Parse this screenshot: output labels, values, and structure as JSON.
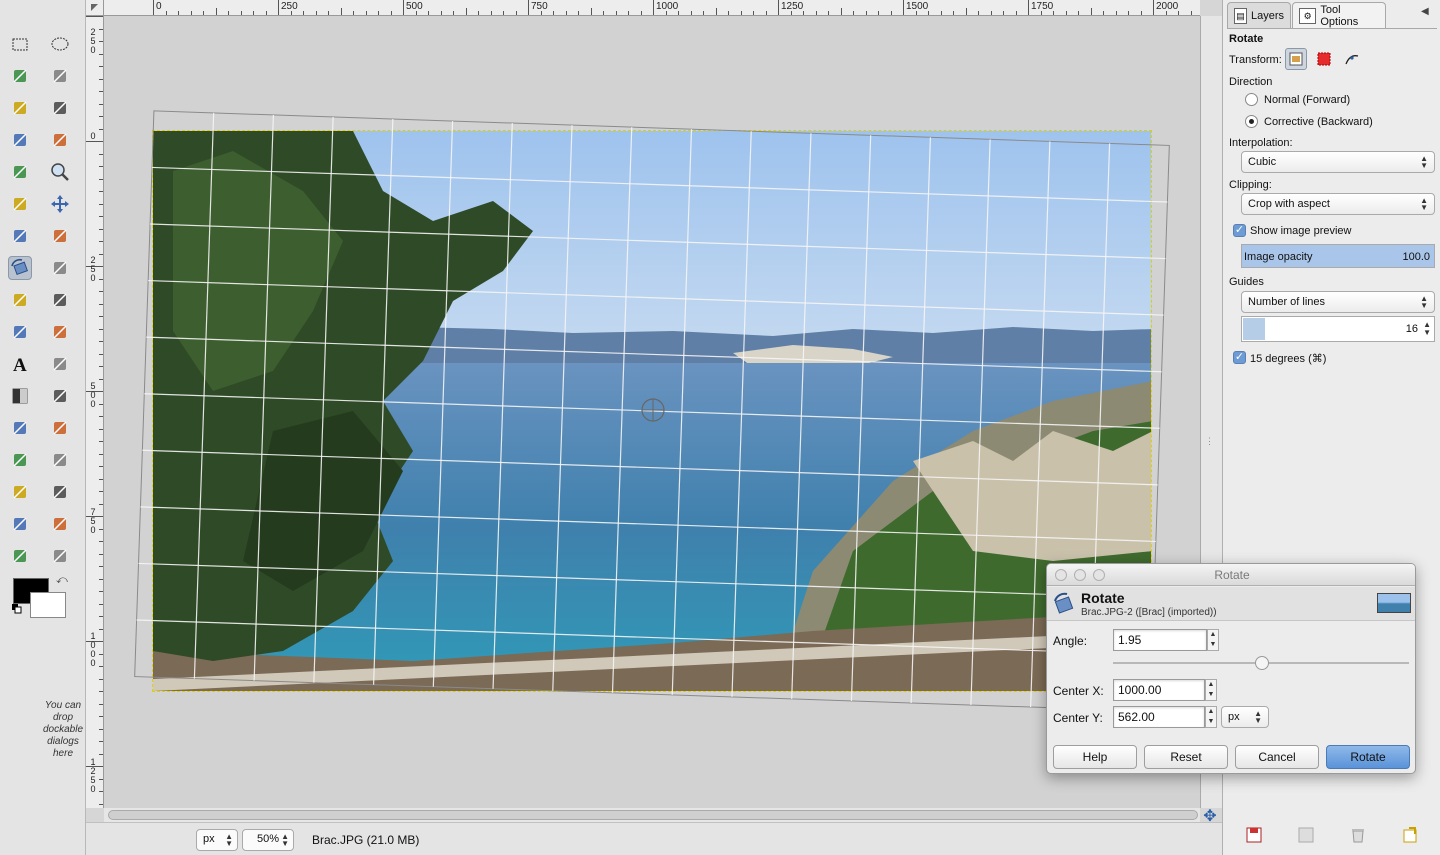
{
  "toolbox": {
    "tools": [
      "rect-select",
      "ellipse-select",
      "free-select",
      "fuzzy-select",
      "select-by-color",
      "scissors-select",
      "foreground-select",
      "paths",
      "color-picker",
      "zoom",
      "measure",
      "move",
      "align",
      "crop",
      "rotate",
      "scale",
      "shear",
      "perspective",
      "flip",
      "cage-transform",
      "text",
      "bucket-fill",
      "blend",
      "pencil",
      "paintbrush",
      "eraser",
      "airbrush",
      "ink",
      "clone",
      "heal",
      "perspective-clone",
      "blur",
      "smudge",
      "dodge-burn"
    ],
    "active_tool": "rotate",
    "dock_hint": "You can drop dockable dialogs here"
  },
  "ruler": {
    "h_labels": [
      "0",
      "250",
      "500",
      "750",
      "1000",
      "1250",
      "1500",
      "1750",
      "2000"
    ],
    "v_labels": [
      [
        "2",
        "5",
        "0"
      ],
      [
        "0"
      ],
      [
        "2",
        "5",
        "0"
      ],
      [
        "5",
        "0",
        "0"
      ],
      [
        "7",
        "5",
        "0"
      ],
      [
        "1",
        "0",
        "0",
        "0"
      ],
      [
        "1",
        "2",
        "5",
        "0"
      ]
    ]
  },
  "statusbar": {
    "unit": "px",
    "zoom": "50%",
    "image_info": "Brac.JPG (21.0 MB)"
  },
  "dock": {
    "tabs": [
      {
        "label": "Layers"
      },
      {
        "label": "Tool Options"
      }
    ],
    "tool_name": "Rotate",
    "transform_label": "Transform:",
    "direction_label": "Direction",
    "direction_options": [
      "Normal (Forward)",
      "Corrective (Backward)"
    ],
    "direction_selected": 1,
    "interpolation_label": "Interpolation:",
    "interpolation_value": "Cubic",
    "clipping_label": "Clipping:",
    "clipping_value": "Crop with aspect",
    "show_preview_label": "Show image preview",
    "opacity_label": "Image opacity",
    "opacity_value": "100.0",
    "guides_label": "Guides",
    "guides_value": "Number of lines",
    "guides_count": "16",
    "fifteen_degrees_label": "15 degrees (⌘)"
  },
  "dialog": {
    "window_title": "Rotate",
    "header_title": "Rotate",
    "header_subtitle": "Brac.JPG-2 ([Brac] (imported))",
    "angle_label": "Angle:",
    "angle_value": "1.95",
    "angle_fraction": 0.505,
    "center_x_label": "Center X:",
    "center_x_value": "1000.00",
    "center_y_label": "Center Y:",
    "center_y_value": "562.00",
    "unit": "px",
    "buttons": {
      "help": "Help",
      "reset": "Reset",
      "cancel": "Cancel",
      "rotate": "Rotate"
    }
  },
  "colors": {
    "accent": "#5a93d8",
    "selection": "#e0d000",
    "foreground": "#000000",
    "background": "#ffffff"
  }
}
